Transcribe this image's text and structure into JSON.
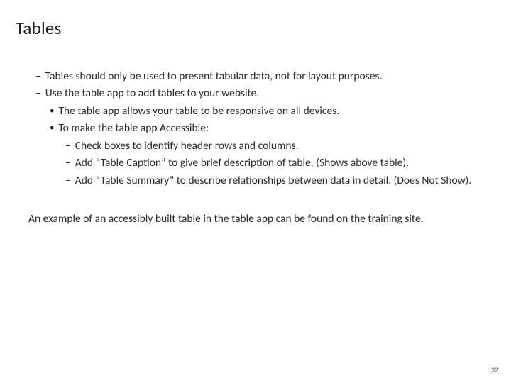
{
  "title": "Tables",
  "bullets": {
    "a1": "Tables should only be used to present tabular data, not for layout purposes.",
    "a2": "Use the table app to add tables to your website.",
    "b1": "The table app allows your table to be responsive on all devices.",
    "b2": "To make the table app Accessible:",
    "c1": "Check boxes to identify header rows and columns.",
    "c2": "Add “Table Caption” to give brief description of table. (Shows above table).",
    "c3": "Add “Table Summary” to describe relationships between data in detail. (Does Not Show)."
  },
  "footer_pre": "An example of an accessibly built table in the table app can be found on the ",
  "footer_link": "training site",
  "footer_post": ".",
  "page_number": "32"
}
